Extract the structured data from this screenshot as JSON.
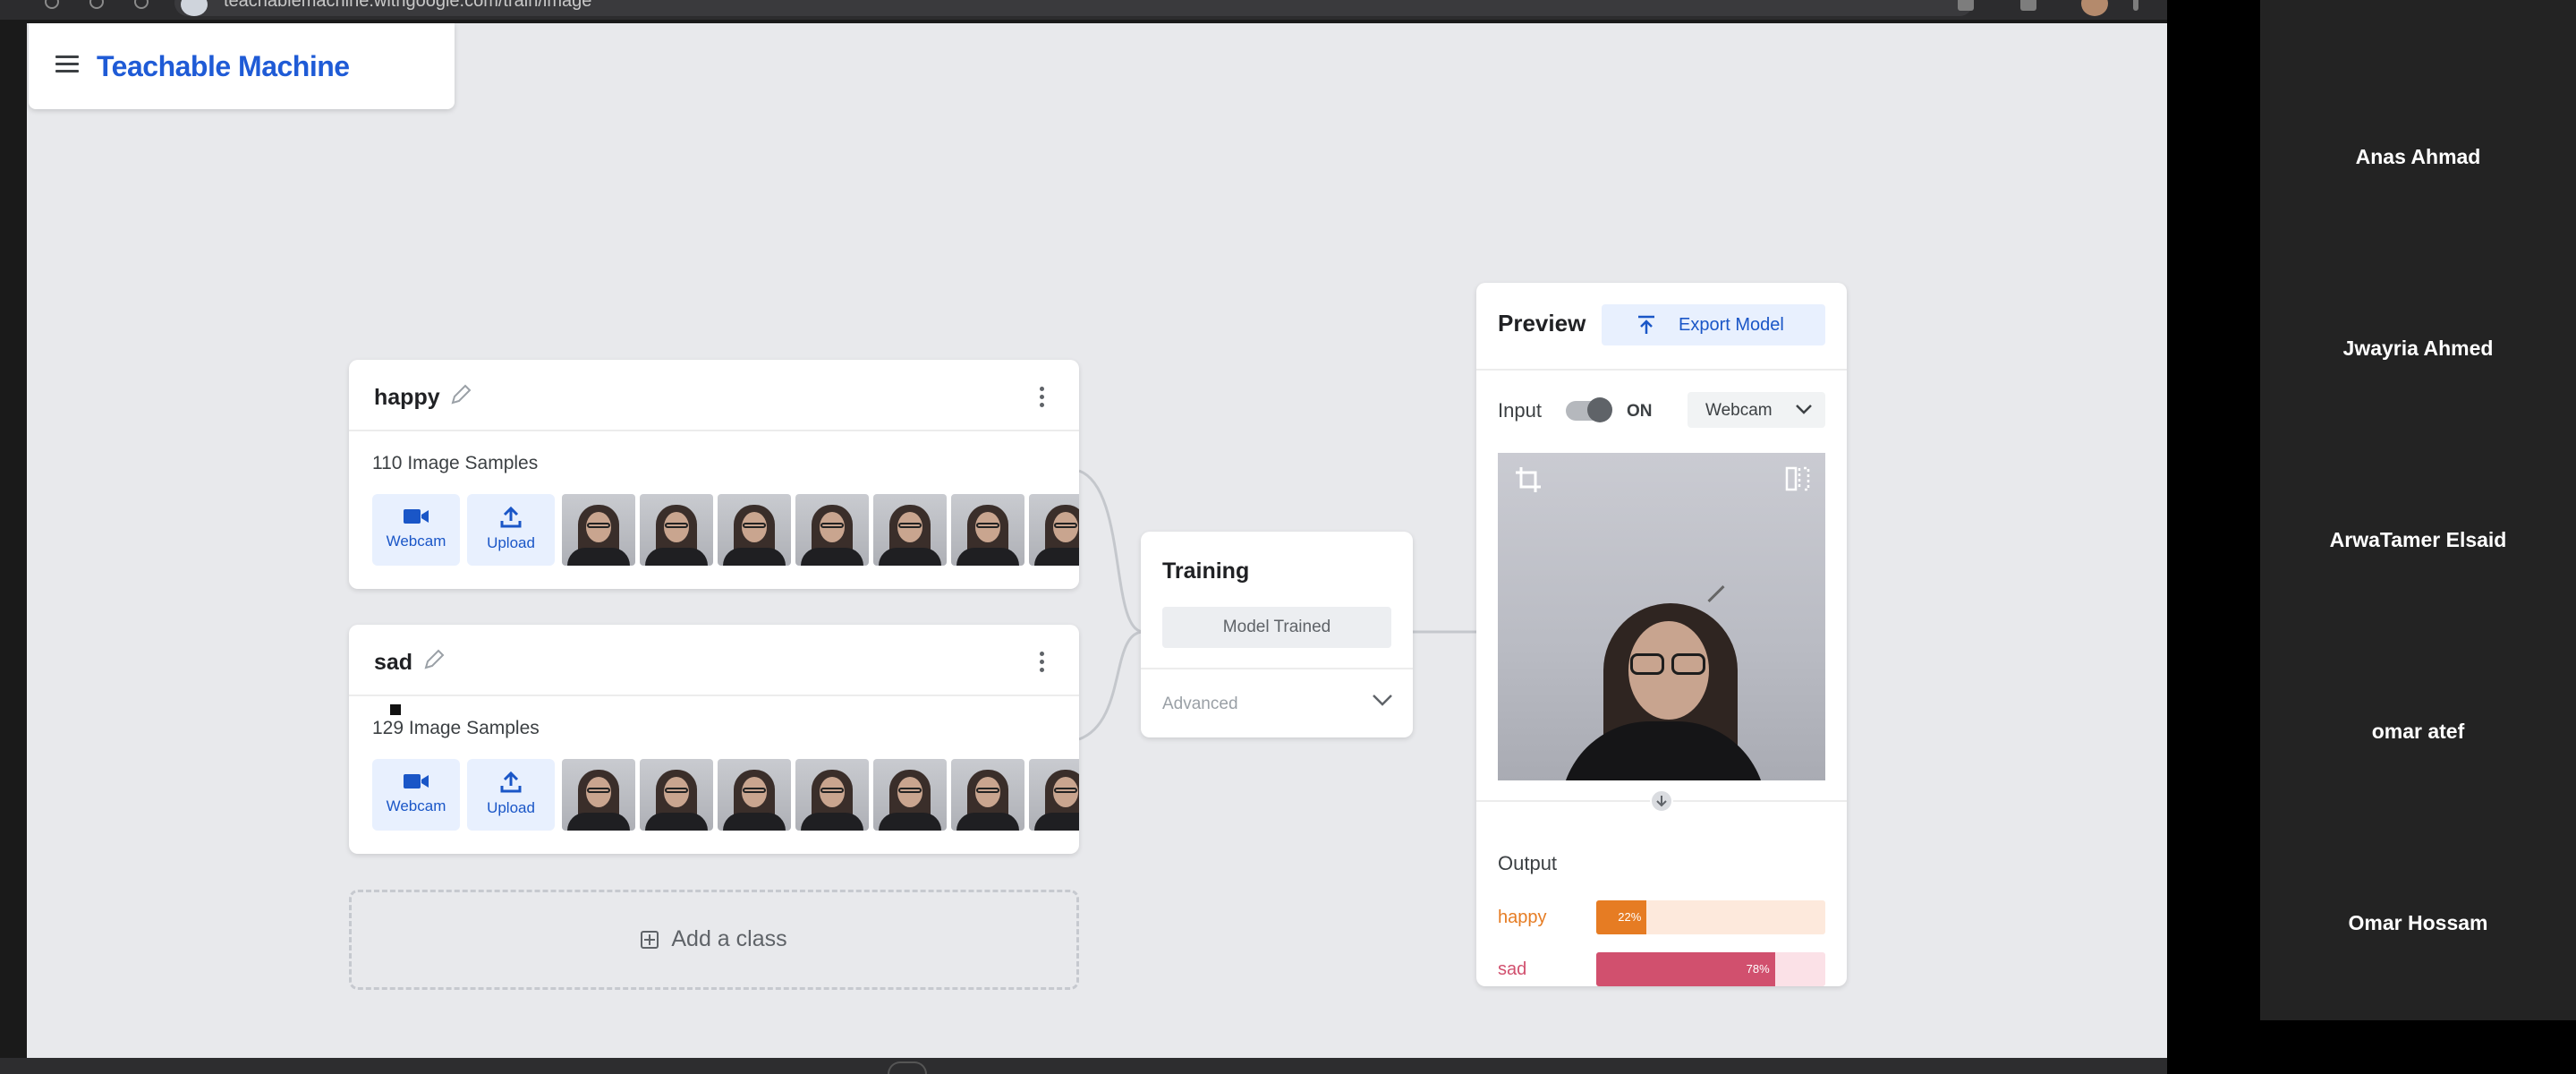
{
  "browser": {
    "url": "teachablemachine.withgoogle.com/train/image"
  },
  "app": {
    "title": "Teachable Machine"
  },
  "classes": [
    {
      "name": "happy",
      "samples": "110 Image Samples",
      "webcam_label": "Webcam",
      "upload_label": "Upload"
    },
    {
      "name": "sad",
      "samples": "129 Image Samples",
      "webcam_label": "Webcam",
      "upload_label": "Upload"
    }
  ],
  "add_class": {
    "label": "Add a class"
  },
  "training": {
    "title": "Training",
    "status_button": "Model Trained",
    "advanced_label": "Advanced"
  },
  "preview": {
    "title": "Preview",
    "export_label": "Export Model",
    "input_label": "Input",
    "toggle_state": "ON",
    "source_select": "Webcam",
    "output_label": "Output",
    "outputs": [
      {
        "label": "happy",
        "percent_text": "22%",
        "value": 0.22,
        "color": "#e67c23",
        "track_color": "#fde9dc"
      },
      {
        "label": "sad",
        "percent_text": "78%",
        "value": 0.78,
        "color": "#d1506e",
        "track_color": "#fbe1e7"
      }
    ]
  },
  "colors": {
    "brand": "#1f5bd6",
    "accent_light": "#e8f0fe"
  },
  "participants": [
    "Anas Ahmad",
    "Jwayria Ahmed",
    "ArwaTamer Elsaid",
    "omar atef",
    "Omar Hossam"
  ]
}
